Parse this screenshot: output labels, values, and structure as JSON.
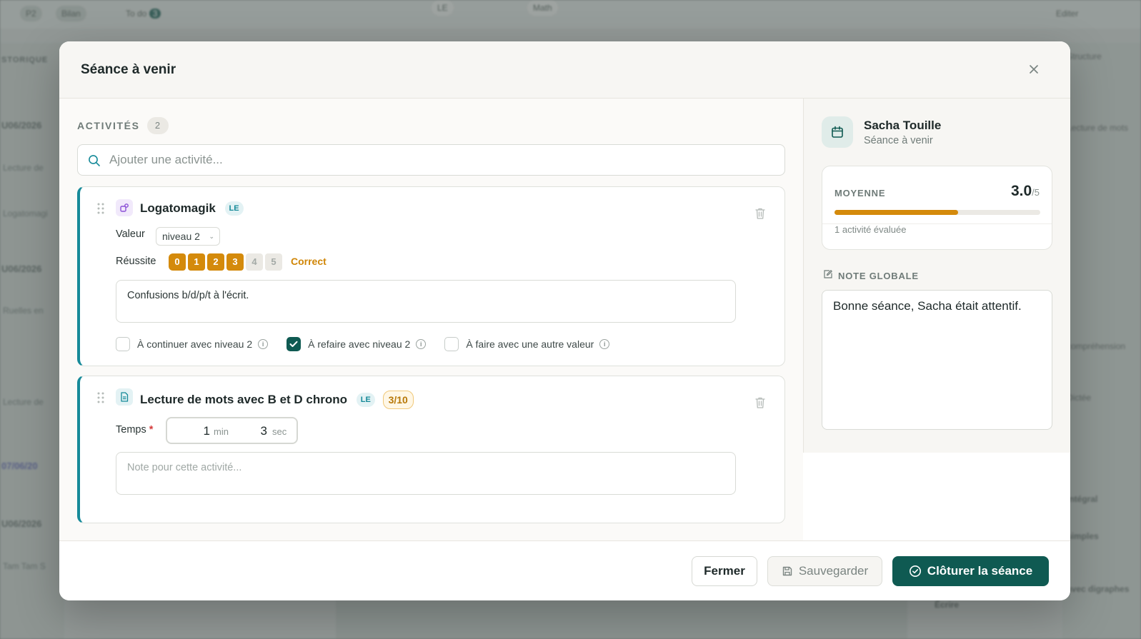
{
  "background": {
    "pills": [
      "P2",
      "Bilan",
      "To do",
      "LE",
      "Math"
    ],
    "todo_count": "3",
    "sidebar_header": "STORIQUE",
    "sidebar_dates": [
      "U06/2026",
      "U06/2026",
      "07/06/20",
      "U06/2026"
    ],
    "sidebar_items": [
      "Lecture de",
      "Logatomagi",
      "Ruelles en",
      "Lecture de",
      "Tam Tam S"
    ],
    "right_items": [
      "Editer",
      "Structure",
      "Lecture de mots",
      "compréhension",
      "Dictée",
      "Intégral",
      "simples",
      "avec digraphes",
      "Écrire"
    ]
  },
  "modal": {
    "title": "Séance à venir",
    "activities_label": "ACTIVITÉS",
    "activities_count": "2",
    "search_placeholder": "Ajouter une activité..."
  },
  "activities": [
    {
      "title": "Logatomagik",
      "tag": "LE",
      "value_label": "Valeur",
      "value_selected": "niveau 2",
      "success_label": "Réussite",
      "scale": [
        "0",
        "1",
        "2",
        "3",
        "4",
        "5"
      ],
      "scale_selected": 3,
      "scale_text": "Correct",
      "note": "Confusions b/d/p/t à l'écrit.",
      "checks": [
        {
          "label": "À continuer avec niveau 2",
          "checked": false
        },
        {
          "label": "À refaire avec niveau 2",
          "checked": true
        },
        {
          "label": "À faire avec une autre valeur",
          "checked": false
        }
      ]
    },
    {
      "title": "Lecture de mots avec B et D chrono",
      "tag": "LE",
      "score": "3/10",
      "time_label": "Temps",
      "required_mark": "*",
      "minutes": "1",
      "min_unit": "min",
      "seconds": "3",
      "sec_unit": "sec",
      "note_placeholder": "Note pour cette activité..."
    }
  ],
  "student": {
    "name": "Sacha Touille",
    "status": "Séance à venir"
  },
  "average": {
    "label": "MOYENNE",
    "value": "3.0",
    "denominator": "/5",
    "fraction": 0.6,
    "evaluated": "1 activité évaluée"
  },
  "global_note": {
    "label": "NOTE GLOBALE",
    "text": "Bonne séance, Sacha était attentif."
  },
  "footer": {
    "close_label": "Fermer",
    "save_label": "Sauvegarder",
    "finish_label": "Clôturer la séance"
  },
  "colors": {
    "accent": "#0f5a52",
    "teal": "#168a99",
    "amber": "#d48a0b"
  }
}
